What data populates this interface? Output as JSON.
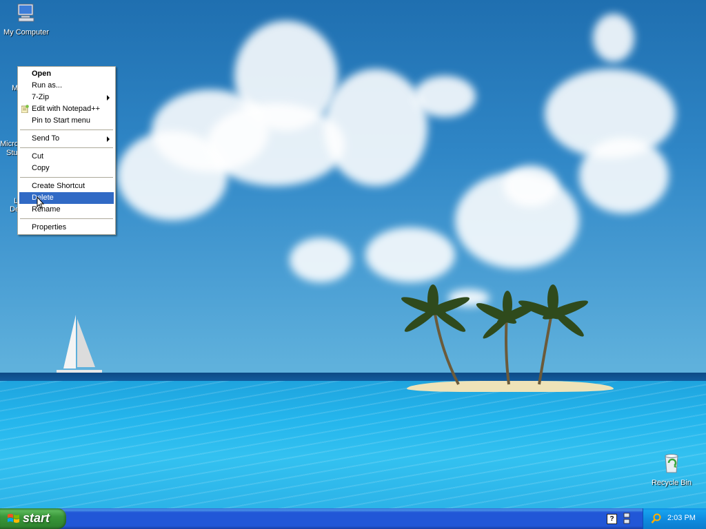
{
  "desktop": {
    "icons": [
      {
        "label": "My Computer",
        "icon": "my-computer-icon"
      },
      {
        "label": "Recycle Bin",
        "icon": "recycle-bin-icon"
      }
    ],
    "partial_labels": [
      "M",
      "Micro",
      "Stu",
      "L",
      "De"
    ]
  },
  "context_menu": {
    "items": [
      {
        "label": "Open",
        "bold": true
      },
      {
        "label": "Run as..."
      },
      {
        "label": "7-Zip",
        "submenu": true
      },
      {
        "label": "Edit with Notepad++",
        "icon": "notepadpp-icon"
      },
      {
        "label": "Pin to Start menu"
      },
      {
        "label": "Send To",
        "submenu": true
      },
      {
        "label": "Cut"
      },
      {
        "label": "Copy"
      },
      {
        "label": "Create Shortcut"
      },
      {
        "label": "Delete",
        "highlighted": true
      },
      {
        "label": "Rename"
      },
      {
        "label": "Properties"
      }
    ]
  },
  "taskbar": {
    "start_label": "start",
    "clock": "2:03 PM",
    "tray_icons": [
      "help-icon",
      "network-icon",
      "search-icon"
    ]
  },
  "colors": {
    "menu_highlight": "#316ac5",
    "taskbar_blue": "#2157d7",
    "start_green": "#3a973a"
  }
}
